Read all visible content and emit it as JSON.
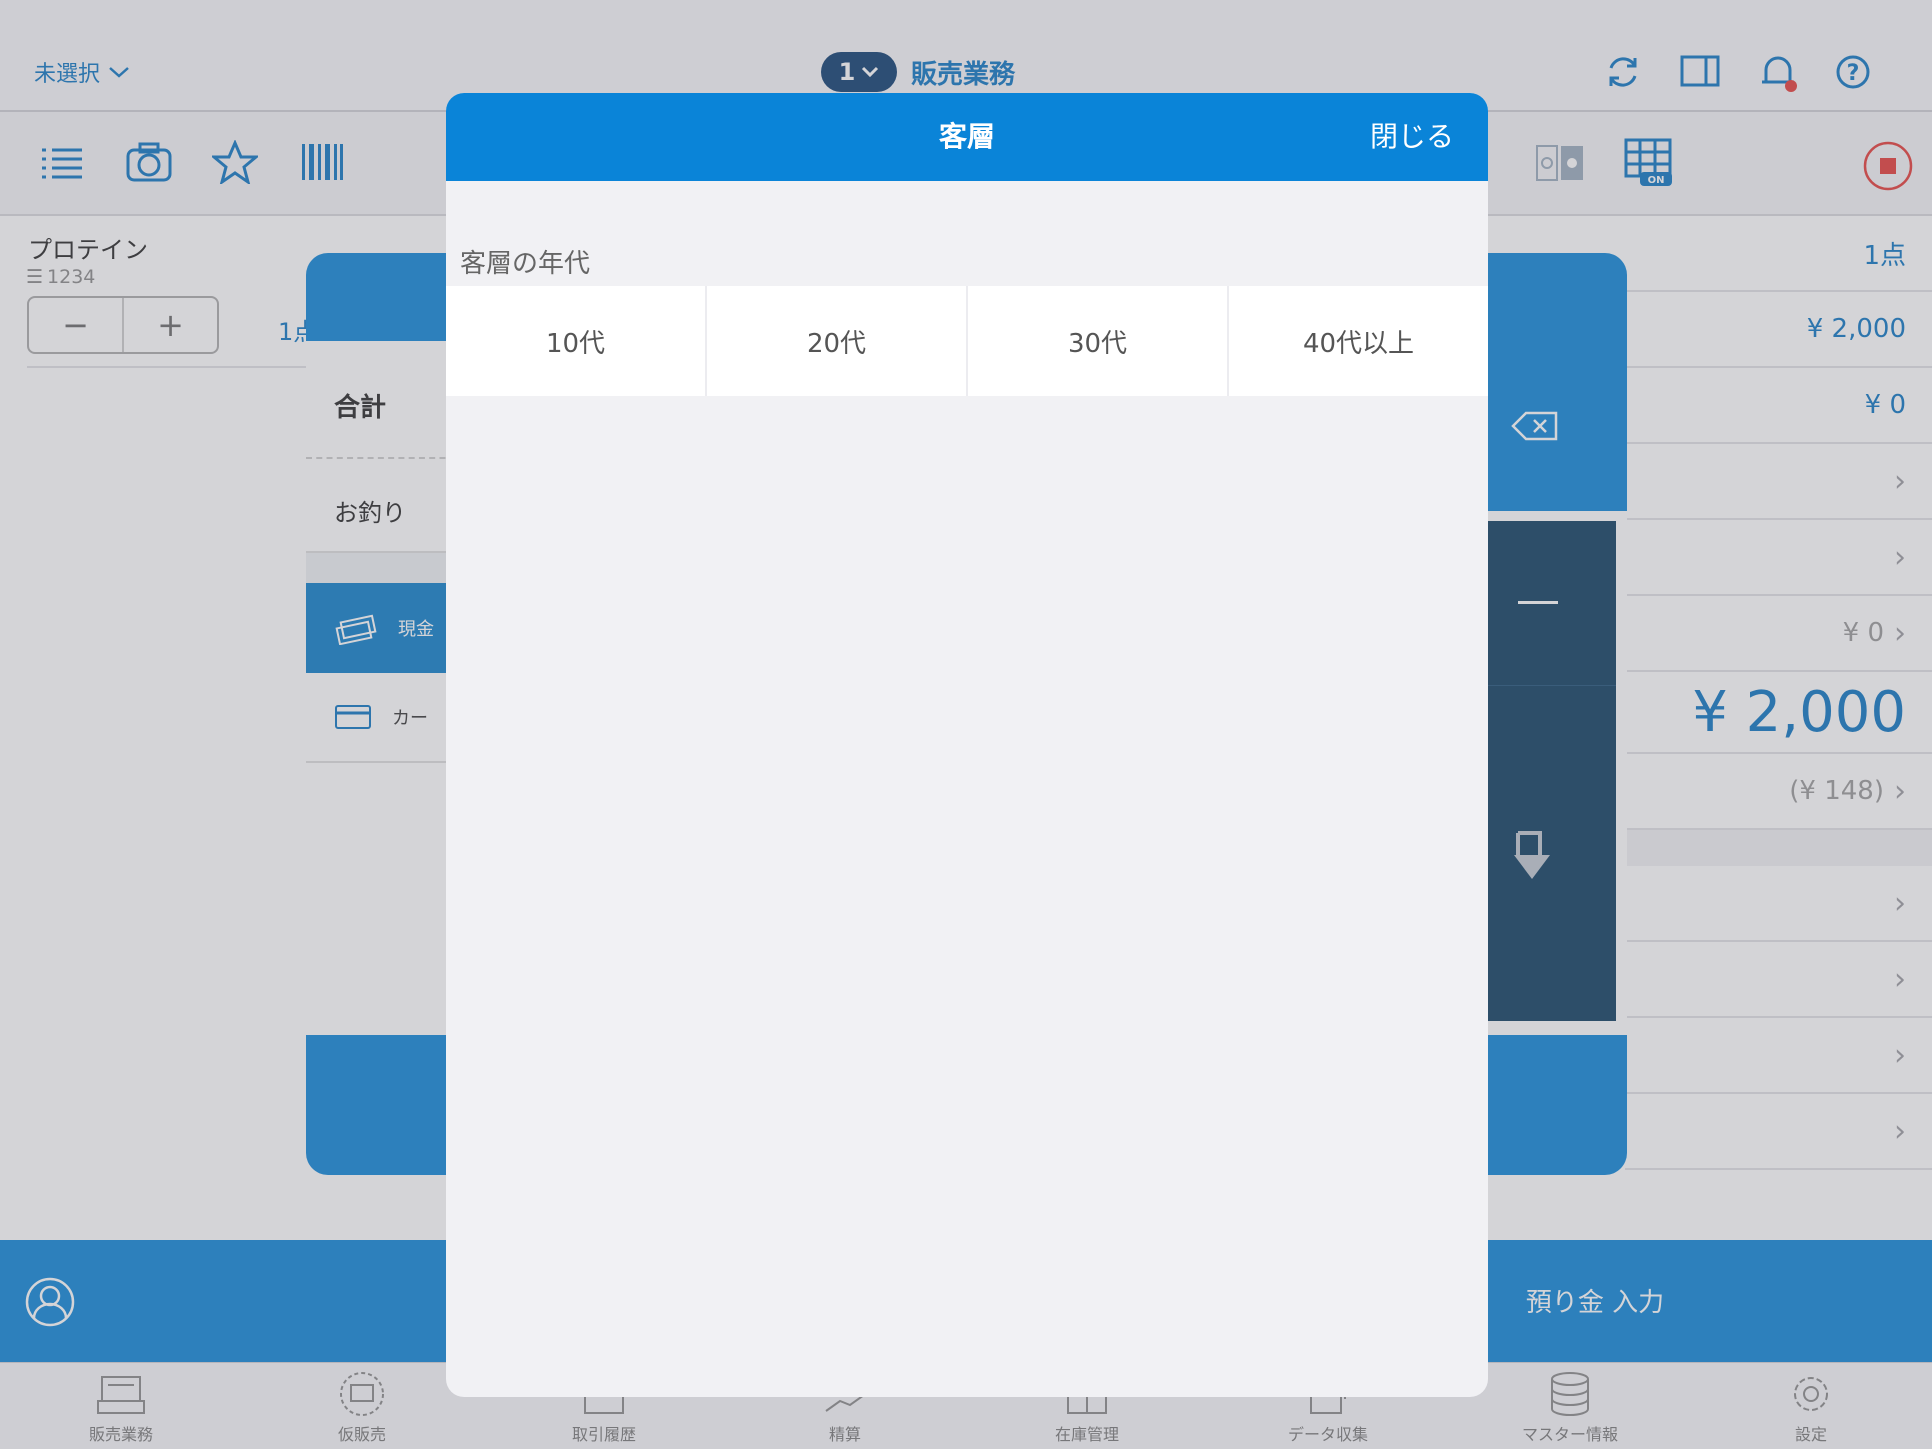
{
  "header": {
    "store_selector": "未選択",
    "register_number": "1",
    "title": "販売業務"
  },
  "cart": {
    "item_name": "プロテイン",
    "item_code": "1234",
    "item_qty_partial": "1点"
  },
  "summary": {
    "count": "1点",
    "subtotal": "¥ 2,000",
    "discount": "¥ 0",
    "row_zero": "¥ 0",
    "total": "¥ 2,000",
    "tax": "(¥ 148)"
  },
  "payment_modal": {
    "total_label": "合計",
    "change_label": "お釣り",
    "cash_label": "現金",
    "card_label": "カー"
  },
  "bottom": {
    "deposit_button": "預り金 入力"
  },
  "customer_modal": {
    "title": "客層",
    "close": "閉じる",
    "section_label": "客層の年代",
    "options": [
      "10代",
      "20代",
      "30代",
      "40代以上"
    ]
  },
  "tabbar": {
    "items": [
      "販売業務",
      "仮販売",
      "取引履歴",
      "精算",
      "在庫管理",
      "データ収集",
      "マスター情報",
      "設定"
    ]
  },
  "colors": {
    "accent": "#0a84d8",
    "accent_text": "#0a74c2",
    "dark_panel": "#0a3a5e",
    "stop_red": "#e53935"
  }
}
